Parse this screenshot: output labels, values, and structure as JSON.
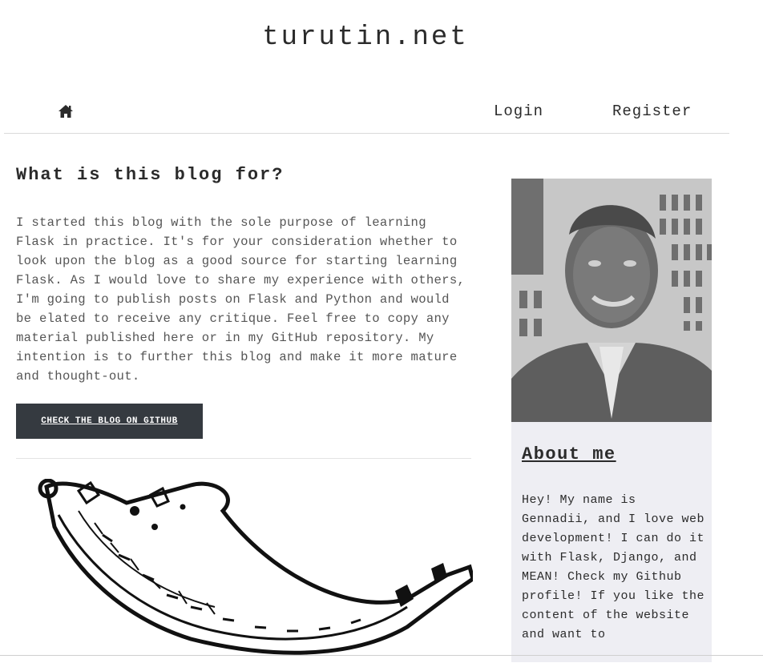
{
  "header": {
    "site_title": "turutin.net"
  },
  "nav": {
    "home_icon": "home-icon",
    "login_label": "Login",
    "register_label": "Register"
  },
  "main": {
    "heading": "What is this blog for?",
    "body": "I started this blog with the sole purpose of learning Flask in practice. It's for your consideration whether to look upon the blog as a good source for starting learning Flask. As I would love to share my experience with others, I'm going to publish posts on Flask and Python and would be elated to receive any critique. Feel free to copy any material published here or in my GitHub repository. My intention is to further this blog and make it more mature and thought-out.",
    "button_label": "CHECK THE BLOG ON GITHUB",
    "illustration_icon": "flask-horn-illustration"
  },
  "sidebar": {
    "about_title": "About me",
    "about_text": "Hey! My name is Gennadii, and I love web development! I can do it with Flask, Django, and MEAN! Check my Github profile! If you like the content of the website and want to"
  },
  "colors": {
    "button_bg": "#353a40",
    "sidebar_bg": "#eeeef3",
    "text": "#2b2b2b"
  }
}
